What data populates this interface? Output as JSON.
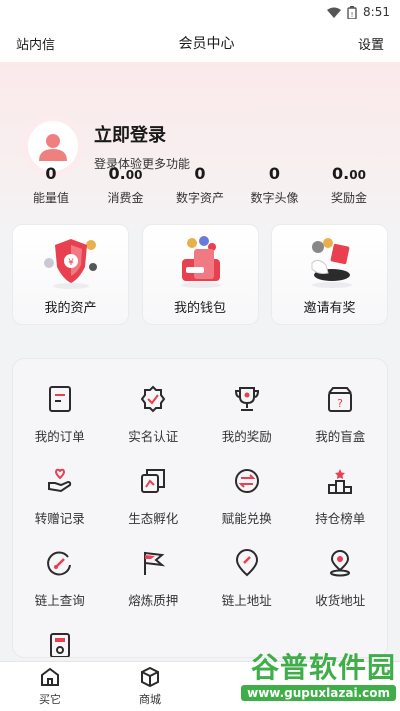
{
  "status_bar": {
    "time": "8:51"
  },
  "header": {
    "left": "站内信",
    "title": "会员中心",
    "right": "设置"
  },
  "profile": {
    "title": "立即登录",
    "subtitle": "登录体验更多功能"
  },
  "stats": [
    {
      "int": "0",
      "dec": "",
      "label": "能量值"
    },
    {
      "int": "0.",
      "dec": "00",
      "label": "消费金"
    },
    {
      "int": "0",
      "dec": "",
      "label": "数字资产"
    },
    {
      "int": "0",
      "dec": "",
      "label": "数字头像"
    },
    {
      "int": "0.",
      "dec": "00",
      "label": "奖励金"
    }
  ],
  "cards": [
    {
      "label": "我的资产"
    },
    {
      "label": "我的钱包"
    },
    {
      "label": "邀请有奖"
    }
  ],
  "grid": [
    {
      "label": "我的订单",
      "icon": "order-icon"
    },
    {
      "label": "实名认证",
      "icon": "verified-badge-icon"
    },
    {
      "label": "我的奖励",
      "icon": "trophy-icon"
    },
    {
      "label": "我的盲盒",
      "icon": "mystery-box-icon"
    },
    {
      "label": "转赠记录",
      "icon": "gift-hand-icon"
    },
    {
      "label": "生态孵化",
      "icon": "incubate-icon"
    },
    {
      "label": "赋能兑换",
      "icon": "exchange-icon"
    },
    {
      "label": "持仓榜单",
      "icon": "ranking-podium-icon"
    },
    {
      "label": "链上查询",
      "icon": "chain-search-icon"
    },
    {
      "label": "熔炼质押",
      "icon": "flag-icon"
    },
    {
      "label": "链上地址",
      "icon": "chain-address-icon"
    },
    {
      "label": "收货地址",
      "icon": "location-pin-icon"
    }
  ],
  "tabs": [
    {
      "label": "买它",
      "icon": "home-icon"
    },
    {
      "label": "商城",
      "icon": "box-icon"
    }
  ],
  "watermark": {
    "name": "谷普软件园",
    "url": "www.gupuxlazai.com"
  },
  "colors": {
    "accent": "#e8404e",
    "icon_dark": "#2b2b2b",
    "watermark": "#3fae49"
  }
}
